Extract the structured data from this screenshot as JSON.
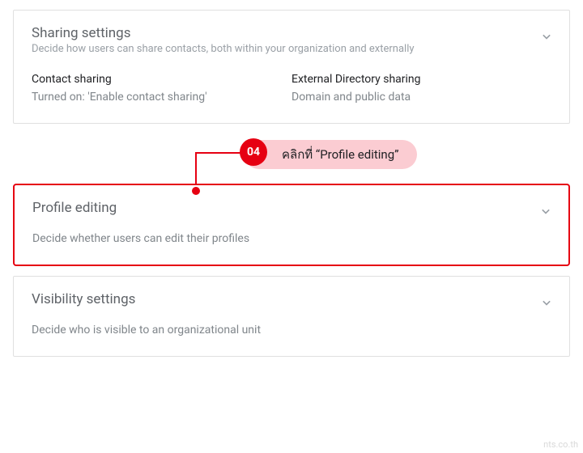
{
  "cards": {
    "sharing": {
      "title": "Sharing settings",
      "subtitle": "Decide how users can share contacts, both within your organization and externally",
      "col1": {
        "label": "Contact sharing",
        "value": "Turned on: 'Enable contact sharing'"
      },
      "col2": {
        "label": "External Directory sharing",
        "value": "Domain and public data"
      }
    },
    "profile": {
      "title": "Profile editing",
      "desc": "Decide whether users can edit their profiles"
    },
    "visibility": {
      "title": "Visibility settings",
      "desc": "Decide who is visible to an organizational unit"
    }
  },
  "callout": {
    "number": "04",
    "text": "คลิกที่ “Profile editing”"
  },
  "watermark": "nts.co.th",
  "colors": {
    "accent": "#e60012",
    "pill": "#fbccd2",
    "border": "#e0e0e0",
    "title": "#5f6368",
    "subtitle": "#9aa0a6",
    "label": "#202124",
    "value": "#80868b"
  }
}
